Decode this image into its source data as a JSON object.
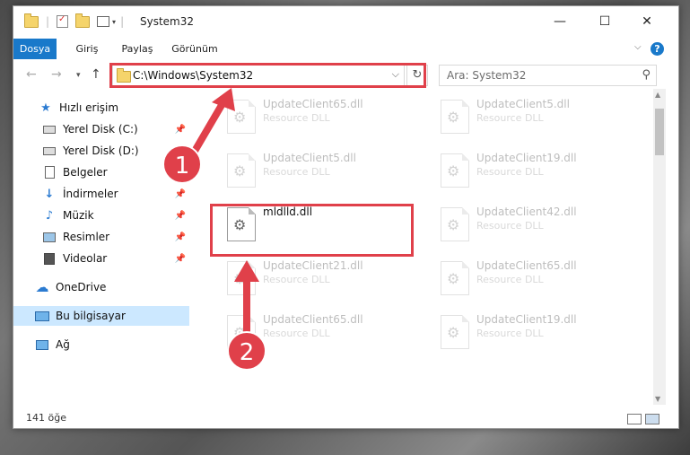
{
  "window": {
    "title": "System32",
    "controls": {
      "minimize": "—",
      "maximize": "☐",
      "close": "✕"
    }
  },
  "ribbon": {
    "tabs": [
      {
        "label": "Dosya",
        "active": true
      },
      {
        "label": "Giriş"
      },
      {
        "label": "Paylaş"
      },
      {
        "label": "Görünüm"
      }
    ],
    "help": "?"
  },
  "address": {
    "path": "C:\\Windows\\System32",
    "search_placeholder": "Ara: System32"
  },
  "sidebar": {
    "items": [
      {
        "label": "Hızlı erişim",
        "icon": "star-icon",
        "pinned": false
      },
      {
        "label": "Yerel Disk (C:)",
        "icon": "drive-icon",
        "pinned": true
      },
      {
        "label": "Yerel Disk (D:)",
        "icon": "drive-icon",
        "pinned": false
      },
      {
        "label": "Belgeler",
        "icon": "documents-icon",
        "pinned": true
      },
      {
        "label": "İndirmeler",
        "icon": "download-icon",
        "pinned": true
      },
      {
        "label": "Müzik",
        "icon": "music-icon",
        "pinned": true
      },
      {
        "label": "Resimler",
        "icon": "pictures-icon",
        "pinned": true
      },
      {
        "label": "Videolar",
        "icon": "videos-icon",
        "pinned": true
      },
      {
        "label": "OneDrive",
        "icon": "cloud-icon"
      },
      {
        "label": "Bu bilgisayar",
        "icon": "computer-icon",
        "selected": true
      },
      {
        "label": "Ağ",
        "icon": "network-icon"
      }
    ]
  },
  "files": [
    {
      "name": "UpdateClient65.dll",
      "desc": "Resource DLL",
      "faded": true
    },
    {
      "name": "UpdateClient5.dll",
      "desc": "Resource DLL",
      "faded": true
    },
    {
      "name": "UpdateClient5.dll",
      "desc": "Resource DLL",
      "faded": true
    },
    {
      "name": "UpdateClient19.dll",
      "desc": "Resource DLL",
      "faded": true
    },
    {
      "name": "mldlld.dll",
      "desc": "",
      "faded": false
    },
    {
      "name": "UpdateClient42.dll",
      "desc": "Resource DLL",
      "faded": true
    },
    {
      "name": "UpdateClient21.dll",
      "desc": "Resource DLL",
      "faded": true
    },
    {
      "name": "UpdateClient65.dll",
      "desc": "Resource DLL",
      "faded": true
    },
    {
      "name": "UpdateClient65.dll",
      "desc": "Resource DLL",
      "faded": true
    },
    {
      "name": "UpdateClient19.dll",
      "desc": "Resource DLL",
      "faded": true
    }
  ],
  "status": {
    "count": "141 öğe"
  },
  "annotations": {
    "step1": "1",
    "step2": "2",
    "color": "#e0404a"
  }
}
